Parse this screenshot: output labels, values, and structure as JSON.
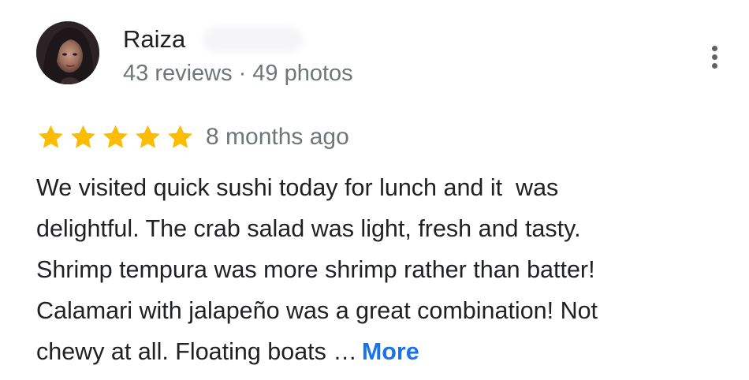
{
  "reviewer": {
    "name": "Raiza",
    "reviews_count": "43 reviews",
    "separator": "·",
    "photos_count": "49 photos"
  },
  "rating": {
    "stars": 5,
    "max_stars": 5,
    "star_color": "#fbbc04",
    "date": "8 months ago"
  },
  "review": {
    "lines": [
      "We visited quick sushi today for lunch and it  was",
      "delightful. The crab salad was light, fresh and tasty.",
      "Shrimp tempura was more shrimp rather than batter!",
      "Calamari with jalapeño was a great combination! Not",
      "chewy at all. Floating boats …"
    ],
    "more_label": "More"
  },
  "colors": {
    "text": "#202124",
    "secondary_text": "#70757a",
    "link": "#1a73e8"
  },
  "icons": {
    "menu": "more-vert-icon",
    "star": "star-icon"
  }
}
